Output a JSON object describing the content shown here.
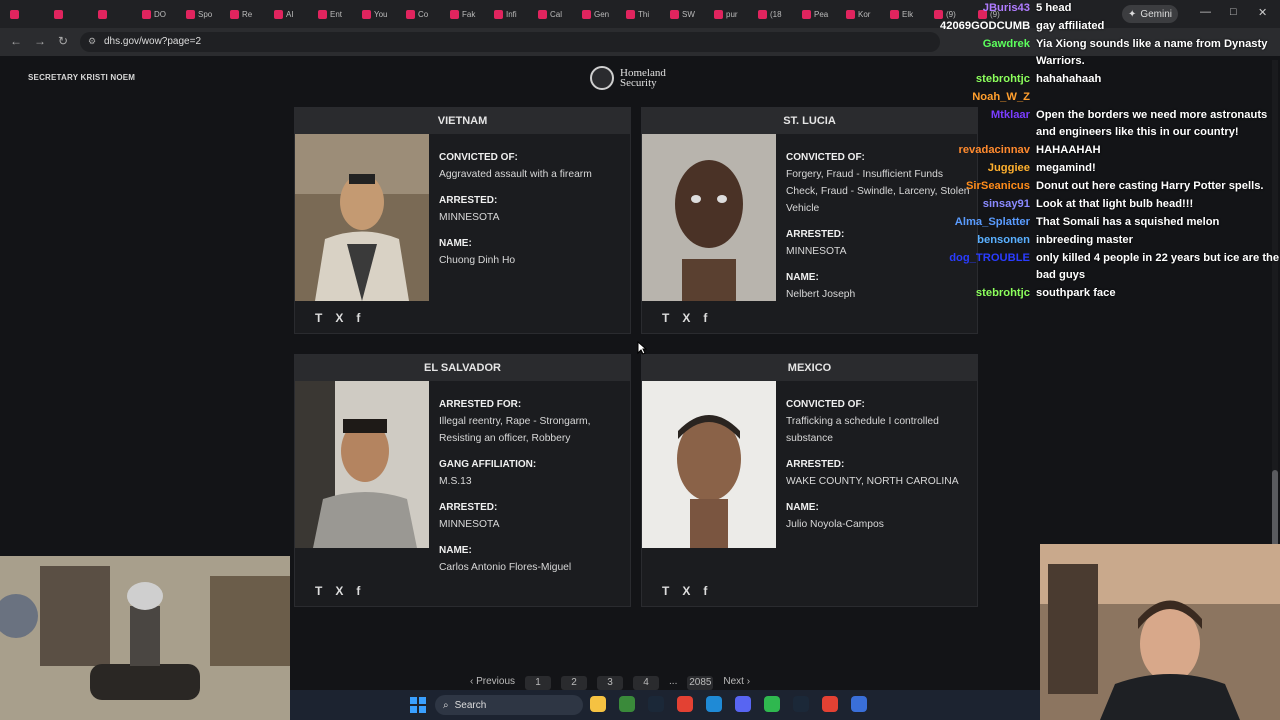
{
  "browser": {
    "tabs": [
      "",
      "",
      "",
      "DO",
      "Spo",
      "Re",
      "AI",
      "Ent",
      "You",
      "Co",
      "Fak",
      "Infi",
      "Cal",
      "Gen",
      "Thi",
      "SW",
      "pur",
      "(18",
      "Pea",
      "Kor",
      "Elk",
      "(9)",
      "(9)"
    ],
    "gemini_label": "Gemini",
    "url": "dhs.gov/wow?page=2",
    "window_controls": [
      "—",
      "□",
      "✕"
    ]
  },
  "page": {
    "secretary": "SECRETARY KRISTI NOEM",
    "logo_line1": "Homeland",
    "logo_line2": "Security",
    "cards": [
      {
        "country": "VIETNAM",
        "fields": [
          {
            "label": "CONVICTED OF:",
            "value": "Aggravated assault with a firearm"
          },
          {
            "label": "ARRESTED:",
            "value": "MINNESOTA"
          },
          {
            "label": "NAME:",
            "value": "Chuong Dinh Ho"
          }
        ]
      },
      {
        "country": "ST. LUCIA",
        "fields": [
          {
            "label": "CONVICTED OF:",
            "value": "Forgery, Fraud - Insufficient Funds Check, Fraud - Swindle, Larceny, Stolen Vehicle"
          },
          {
            "label": "ARRESTED:",
            "value": "MINNESOTA"
          },
          {
            "label": "NAME:",
            "value": "Nelbert Joseph"
          }
        ]
      },
      {
        "country": "EL SALVADOR",
        "fields": [
          {
            "label": "ARRESTED FOR:",
            "value": "Illegal reentry, Rape - Strongarm, Resisting an officer, Robbery"
          },
          {
            "label": "GANG AFFILIATION:",
            "value": "M.S.13"
          },
          {
            "label": "ARRESTED:",
            "value": "MINNESOTA"
          },
          {
            "label": "NAME:",
            "value": "Carlos Antonio Flores-Miguel"
          }
        ]
      },
      {
        "country": "MEXICO",
        "fields": [
          {
            "label": "CONVICTED OF:",
            "value": "Trafficking a schedule I controlled substance"
          },
          {
            "label": "ARRESTED:",
            "value": "WAKE COUNTY, NORTH CAROLINA"
          },
          {
            "label": "NAME:",
            "value": "Julio Noyola-Campos"
          }
        ]
      }
    ],
    "share_icons": [
      "T",
      "X",
      "f"
    ],
    "pagination": {
      "previous": "‹ Previous",
      "pages": [
        "1",
        "2",
        "3",
        "4",
        "...",
        "2085"
      ],
      "next": "Next ›"
    }
  },
  "chat": [
    {
      "user": "JBuris43",
      "text": "5 head",
      "color": "#b07cff"
    },
    {
      "user": "42069GODCUMB",
      "text": "gay affiliated",
      "color": "#ffffff"
    },
    {
      "user": "Gawdrek",
      "text": "Yia Xiong sounds like a name from Dynasty Warriors.",
      "color": "#5cff5c"
    },
    {
      "user": "stebrohtjc",
      "text": "hahahahaah",
      "color": "#8cff5c"
    },
    {
      "user": "Noah_W_Z",
      "text": "",
      "color": "#ff9f2e"
    },
    {
      "user": "Mtklaar",
      "text": "Open the borders we need more astronauts and engineers like this in our country!",
      "color": "#7a3cff"
    },
    {
      "user": "revadacinnav",
      "text": "HAHAAHAH",
      "color": "#ff8a2e"
    },
    {
      "user": "Juggiee",
      "text": "megamind!",
      "color": "#ffb02e"
    },
    {
      "user": "SirSeanicus",
      "text": "Donut out here casting Harry Potter spells.",
      "color": "#ff8c1a"
    },
    {
      "user": "sinsay91",
      "text": "Look at that light bulb head!!!",
      "color": "#8a8aff"
    },
    {
      "user": "Alma_Splatter",
      "text": "That Somali has a squished melon",
      "color": "#5a9cff"
    },
    {
      "user": "bensonen",
      "text": "inbreeding master",
      "color": "#5ab0ff"
    },
    {
      "user": "dog_TROUBLE",
      "text": "only killed 4 people in 22 years but ice are the bad guys",
      "color": "#2a3cff"
    },
    {
      "user": "stebrohtjc",
      "text": "southpark face",
      "color": "#8cff5c"
    }
  ],
  "taskbar": {
    "search_label": "Search",
    "apps": [
      "file-explorer",
      "game-app",
      "steam",
      "chrome",
      "edge",
      "discord",
      "xbox",
      "steam-2",
      "chrome-2",
      "browser"
    ]
  }
}
